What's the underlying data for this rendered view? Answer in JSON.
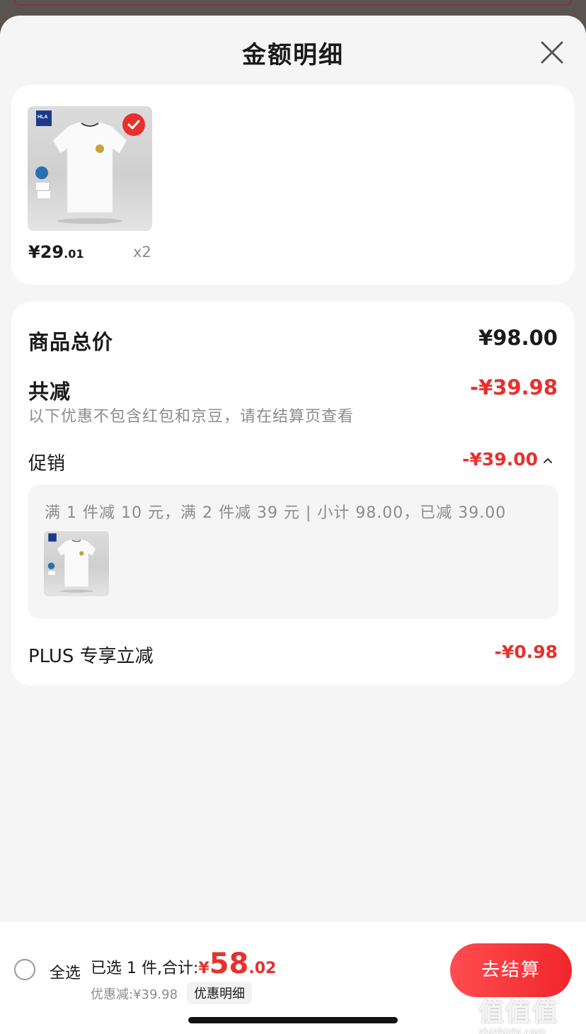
{
  "header": {
    "title": "金额明细"
  },
  "product": {
    "brand_text": "HLA",
    "price_main": "¥29",
    "price_decimal": ".01",
    "quantity": "x2"
  },
  "summary": {
    "total_label": "商品总价",
    "total_value": "¥98.00",
    "reduce_label": "共减",
    "reduce_value": "-¥39.98",
    "hint": "以下优惠不包含红包和京豆，请在结算页查看",
    "promo_label": "促销",
    "promo_value": "-¥39.00",
    "promo_detail": "满 1 件减 10 元，满 2 件减 39 元 | 小计 98.00，已减 39.00",
    "plus_label": "PLUS 专享立减",
    "plus_value": "-¥0.98"
  },
  "footer": {
    "select_all": "全选",
    "selected_label": "已选 1 件,合计:",
    "total_yen": "¥",
    "total_main": "58",
    "total_decimal": ".02",
    "discount_text": "优惠减:¥39.98",
    "discount_detail_button": "优惠明细",
    "checkout_button": "去结算",
    "watermark": "值值值",
    "watermark_sub": "zhizhizhi.com"
  },
  "colors": {
    "accent": "#e8302c",
    "text": "#1a1a1a",
    "muted": "#8c8c8c",
    "background": "#f5f5f5"
  },
  "icons": {
    "close": "close-icon",
    "check": "check-icon",
    "caret": "chevron-up-icon"
  }
}
